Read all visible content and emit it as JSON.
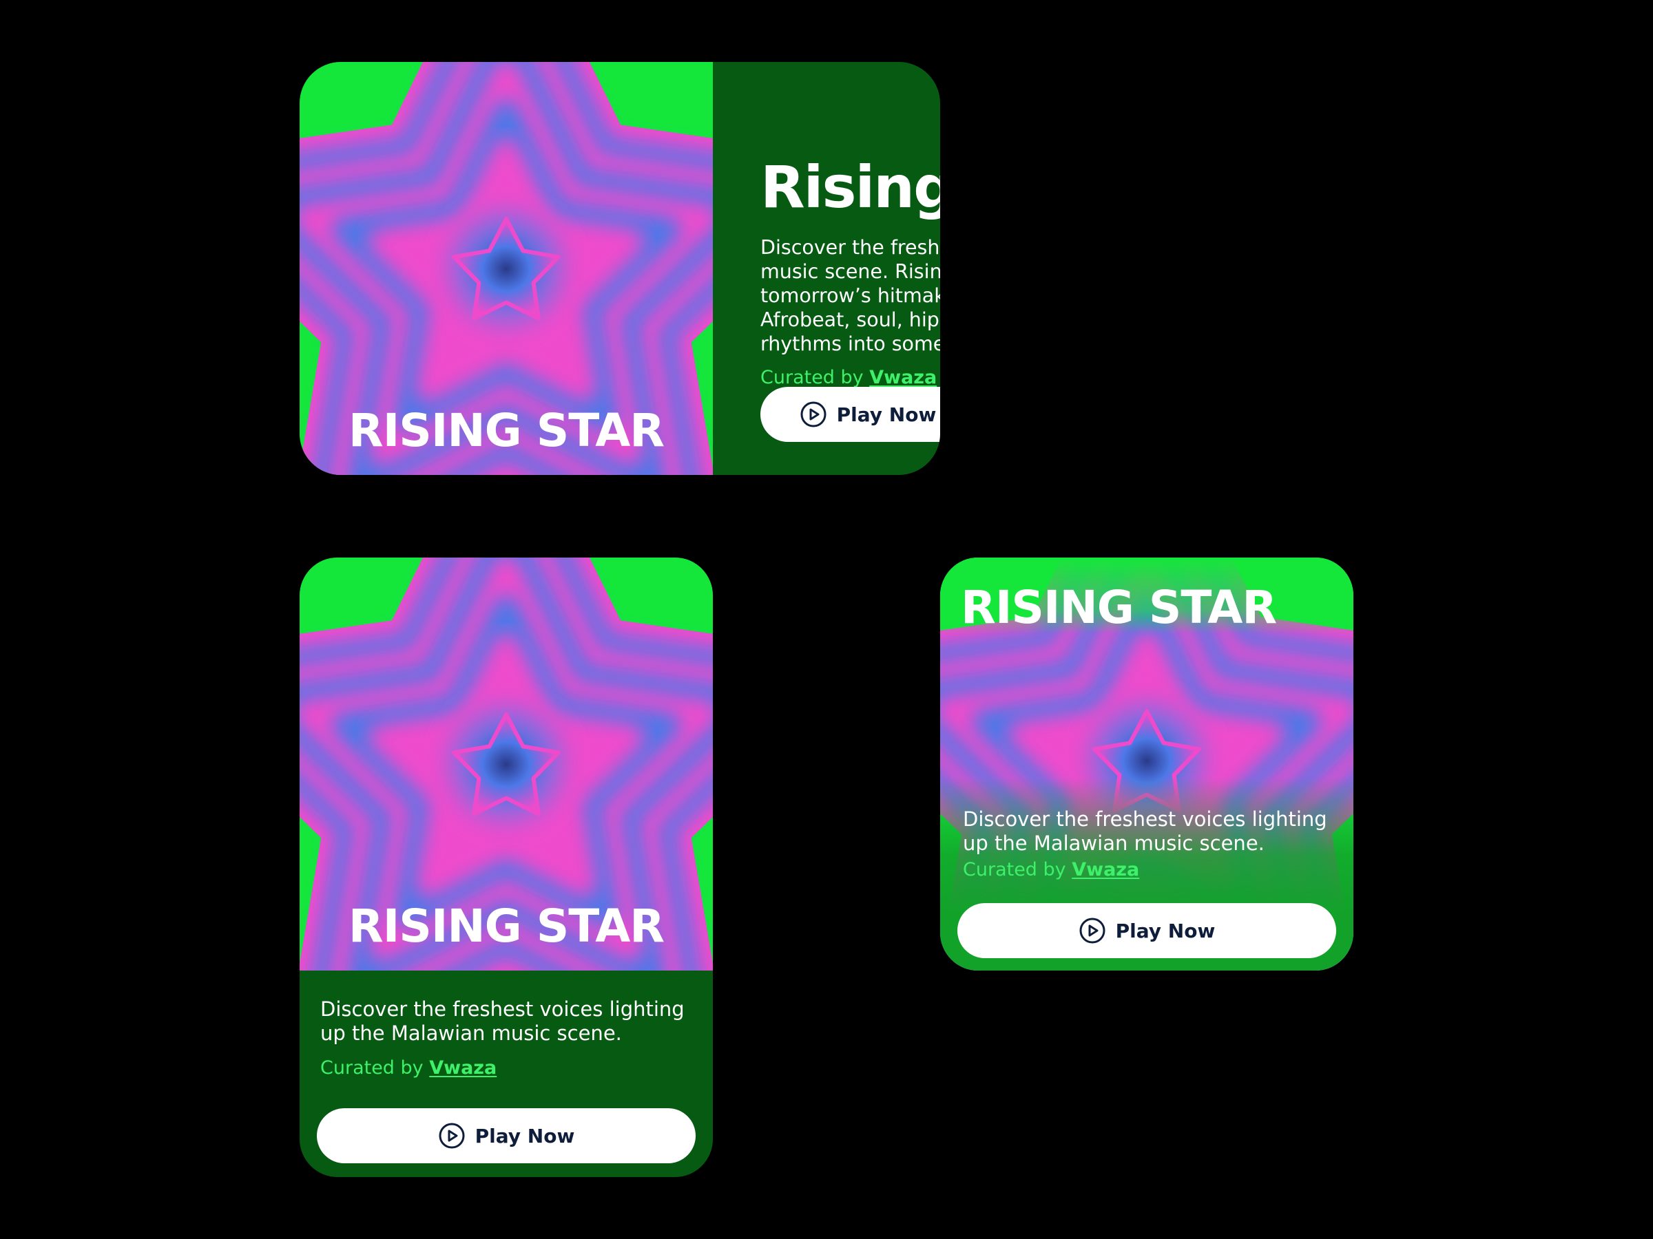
{
  "brand_label": "RISING STAR",
  "playlist": {
    "title": "Rising Star Playlist",
    "description_long": "Discover the freshest voices lighting up the Malawian music scene. Rising Star is your front-row seat to tomorrow’s hitmakers — genre-defying talents blending Afrobeat, soul, hip-hop, amapiano, and traditional rhythms into something uniquely homegrown.",
    "description_short": "Discover the freshest voices lighting up the Malawian music scene.",
    "curated_prefix": "Curated by",
    "curator": "Vwaza",
    "play_label": "Play Now"
  },
  "icons": {
    "play": "play-circle-icon",
    "art": "star-burst-artwork"
  },
  "colors": {
    "background": "#000000",
    "card_dark_green": "#065a12",
    "card_bright_green": "#12a22a",
    "neon_green": "#14e73a",
    "pink": "#ee4bcc",
    "blue": "#4d78e8",
    "curated_green": "#3ef06a",
    "button_text": "#0e1d3a",
    "white": "#ffffff"
  }
}
